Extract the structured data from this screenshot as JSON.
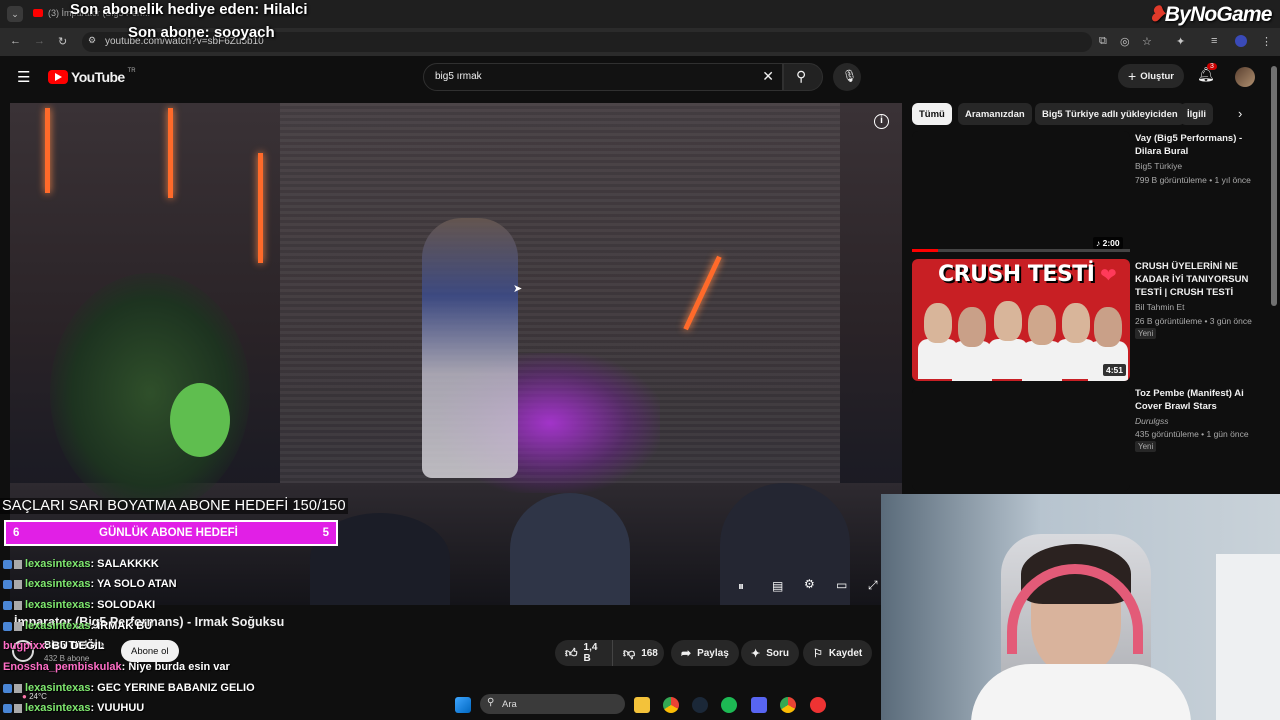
{
  "browser": {
    "tab_title": "(3) İmparator (Big5 Perf...",
    "url": "youtube.com/watch?v=sbF6Zu5b10",
    "colors": {
      "tabbar": "#1f1f1f",
      "addrbar": "#2b2b2b"
    }
  },
  "stream_overlay": {
    "top_line1": "Son abonelik hediye eden: Hilalci",
    "top_line2": "Son abone: sooyach",
    "brand": "ByNoGame",
    "goal_text": "SAÇLARI SARI BOYATMA ABONE HEDEFİ 150/150",
    "daily_goal": {
      "label": "GÜNLÜK ABONE HEDEFİ",
      "left": "6",
      "right": "5",
      "color": "#e11fe6"
    },
    "chat": [
      {
        "user": "lexasintexas",
        "msg": ": SALAKKKK"
      },
      {
        "user": "lexasintexas",
        "msg": ": YA SOLO ATAN"
      },
      {
        "user": "lexasintexas",
        "msg": ": SOLODAKI"
      },
      {
        "user": "lexasintexas",
        "msg": ": İRMAK BU"
      },
      {
        "user": "bugpixx",
        "msg": ": BU DEĞİL"
      },
      {
        "user": "Enossha_pembiskulak",
        "msg": ": Niye burda esin var"
      },
      {
        "user": "lexasintexas",
        "msg": ": GEC YERINE BABANIZ GELIO"
      },
      {
        "user": "lexasintexas",
        "msg": ": VUUHUU"
      }
    ]
  },
  "youtube": {
    "logo_text": "YouTube",
    "logo_sup": "TR",
    "search_value": "big5 ırmak",
    "create_label": "Oluştur",
    "notif_count": "3",
    "video_title": "İmparator (Big5 Performans) - Irmak Soğuksu",
    "channel_name": "Big5 Türkiye",
    "subscriber_count": "432 B abone",
    "subscribe_label": "Abone ol",
    "like_count": "1,4 B",
    "dislike_count": "168",
    "share_label": "Paylaş",
    "ask_label": "Soru",
    "save_label": "Kaydet"
  },
  "sidebar": {
    "chips": [
      "Tümü",
      "Aramanızdan",
      "Big5 Türkiye adlı yükleyiciden",
      "İlgili"
    ],
    "videos": [
      {
        "title": "Vay (Big5 Performans) - Dilara Bural",
        "channel": "Big5 Türkiye",
        "meta": "799 B görüntüleme • 1 yıl önce",
        "duration": "2:00",
        "badge": ""
      },
      {
        "title": "CRUSH ÜYELERİNİ NE KADAR İYİ TANIYORSUN TESTİ | CRUSH TESTİ",
        "channel": "Bil Tahmin Et",
        "meta": "26 B görüntüleme • 3 gün önce",
        "duration": "4:51",
        "badge": "Yeni",
        "thumb_text": "CRUSH TESTİ"
      },
      {
        "title": "Toz Pembe (Manifest) Ai Cover Brawl Stars",
        "channel": "Durulgss",
        "meta": "435 görüntüleme • 1 gün önce",
        "duration": "",
        "badge": "Yeni"
      }
    ]
  },
  "taskbar": {
    "search_placeholder": "Ara",
    "weather": "24°C"
  }
}
